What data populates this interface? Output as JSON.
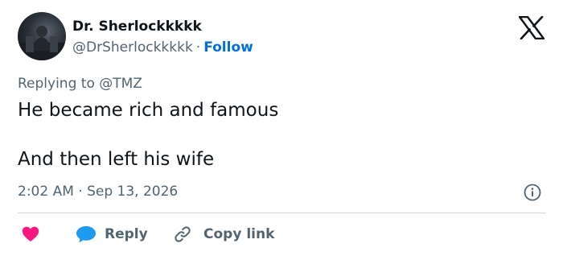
{
  "author": {
    "display_name": "Dr. Sherlockkkkk",
    "handle": "@DrSherlockkkkk",
    "separator": "·",
    "follow_label": "Follow"
  },
  "tweet": {
    "replying_to": "Replying to @TMZ",
    "lines": [
      "He became rich and famous",
      "And then left his wife"
    ],
    "timestamp": "2:02 AM · Sep 13, 2026"
  },
  "actions": {
    "reply_label": "Reply",
    "copy_link_label": "Copy link"
  },
  "icons": {
    "brand": "x-logo-icon",
    "info": "info-icon",
    "like": "heart-icon",
    "reply": "speech-bubble-icon",
    "copy": "link-icon"
  },
  "colors": {
    "text": "#0f1419",
    "secondary": "#536471",
    "accent": "#006fd6",
    "like": "#f91880",
    "reply": "#1d9bf0",
    "divider": "#cfd9de"
  }
}
